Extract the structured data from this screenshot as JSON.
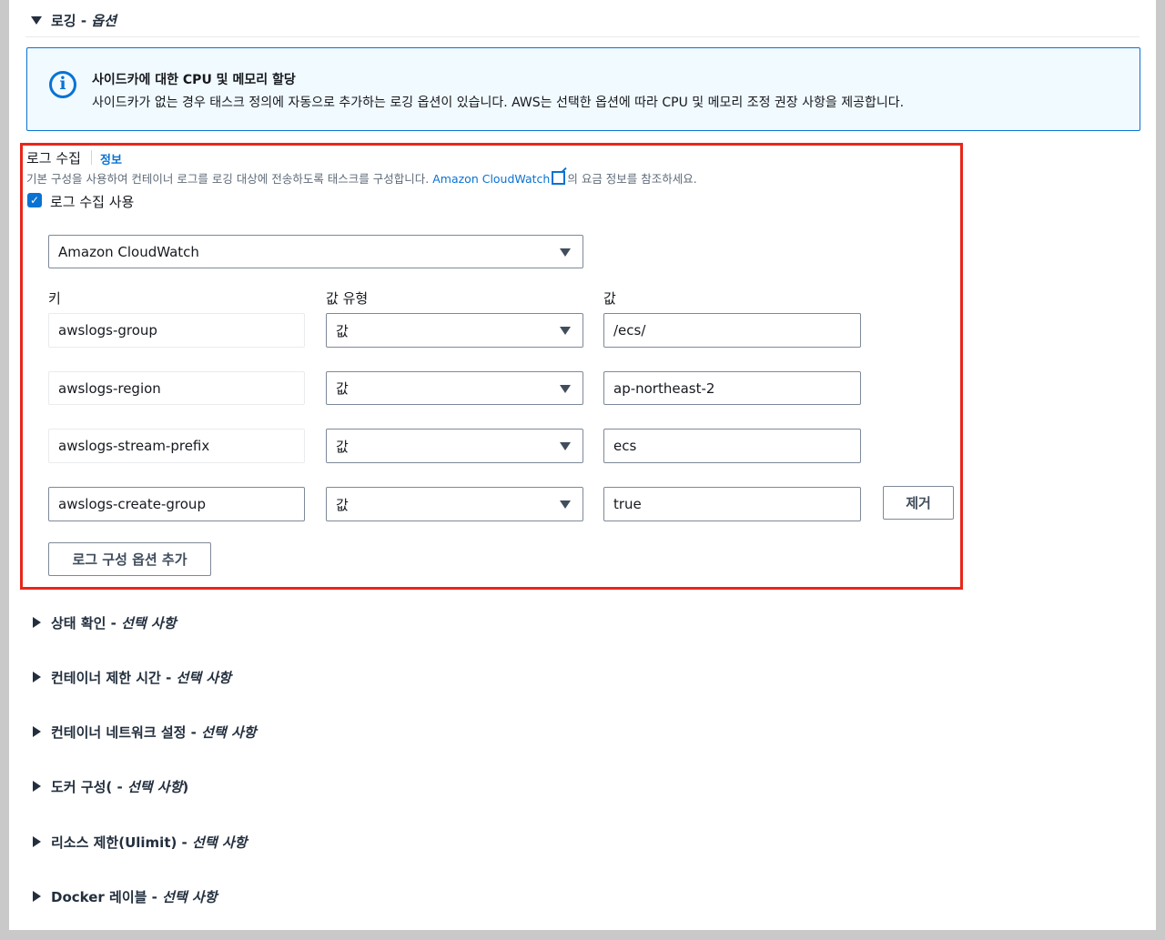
{
  "logging_section": {
    "title": "로깅 - ",
    "title_italic": "옵션"
  },
  "alert": {
    "title": "사이드카에 대한 CPU 및 메모리 할당",
    "body": "사이드카가 없는 경우 태스크 정의에 자동으로 추가하는 로깅 옵션이 있습니다. AWS는 선택한 옵션에 따라 CPU 및 메모리 조정 권장 사항을 제공합니다."
  },
  "log_collection": {
    "label": "로그 수집",
    "info_link": "정보",
    "description_pre": "기본 구성을 사용하여 컨테이너 로그를 로깅 대상에 전송하도록 태스크를 구성합니다. ",
    "description_link": "Amazon CloudWatch",
    "description_post": "의 요금 정보를 참조하세요.",
    "checkbox_label": "로그 수집 사용",
    "checkbox_checked": true,
    "destination": "Amazon CloudWatch",
    "columns": {
      "key": "키",
      "value_type": "값 유형",
      "value": "값"
    },
    "rows": [
      {
        "key": "awslogs-group",
        "type": "값",
        "value": "/ecs/"
      },
      {
        "key": "awslogs-region",
        "type": "값",
        "value": "ap-northeast-2"
      },
      {
        "key": "awslogs-stream-prefix",
        "type": "값",
        "value": "ecs"
      },
      {
        "key": "awslogs-create-group",
        "type": "값",
        "value": "true"
      }
    ],
    "remove_label": "제거",
    "add_label": "로그 구성 옵션 추가"
  },
  "collapsed_sections": [
    {
      "title": "상태 확인 - ",
      "italic": "선택 사항"
    },
    {
      "title": "컨테이너 제한 시간 - ",
      "italic": "선택 사항"
    },
    {
      "title": "컨테이너 네트워크 설정 - ",
      "italic": "선택 사항"
    },
    {
      "title": "도커 구성( - ",
      "italic": "선택 사항",
      "suffix": ")"
    },
    {
      "title": "리소스 제한(Ulimit) - ",
      "italic": "선택 사항"
    },
    {
      "title": "Docker 레이블 - ",
      "italic": "선택 사항"
    }
  ],
  "colors": {
    "accent": "#0972d3",
    "highlight_border": "#e8261a",
    "alert_bg": "#f1faff"
  },
  "icons": [
    "caret-down-icon",
    "info-circle-icon",
    "external-link-icon",
    "checkbox-checked-icon",
    "caret-right-icon"
  ]
}
